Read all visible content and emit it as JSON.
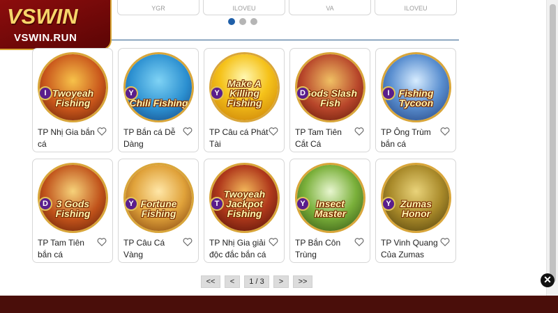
{
  "logo": {
    "brand": "VSWIN",
    "url": "VSWIN.RUN"
  },
  "top_cards": [
    "YGR",
    "ILOVEU",
    "VA",
    "ILOVEU"
  ],
  "games": [
    {
      "name": "TP Nhị Gia bắn cá",
      "badge": "I",
      "art": "Twoyeah Fishing"
    },
    {
      "name": "TP Bắn cá Dễ Dàng",
      "badge": "Y",
      "art": "Chili Fishing"
    },
    {
      "name": "TP Câu cá Phát Tài",
      "badge": "Y",
      "art": "Make A Killing Fishing"
    },
    {
      "name": "TP Tam Tiên Cắt Cá",
      "badge": "D",
      "art": "Gods Slash Fish"
    },
    {
      "name": "TP Ông Trùm bắn cá",
      "badge": "I",
      "art": "Fishing Tycoon"
    },
    {
      "name": "TP Tam Tiên bắn cá",
      "badge": "D",
      "art": "3 Gods Fishing"
    },
    {
      "name": "TP Câu Cá Vàng",
      "badge": "Y",
      "art": "Fortune Fishing"
    },
    {
      "name": "TP Nhị Gia giải độc đắc bắn cá",
      "badge": "T",
      "art": "Twoyeah Jackpot Fishing"
    },
    {
      "name": "TP Bắn Côn Trùng",
      "badge": "Y",
      "art": "Insect Master"
    },
    {
      "name": "TP Vinh Quang Của Zumas",
      "badge": "Y",
      "art": "Zumas Honor"
    }
  ],
  "pagination": {
    "first": "<<",
    "prev": "<",
    "page": "1 / 3",
    "next": ">",
    "last": ">>"
  },
  "close_label": "✕",
  "colors": {
    "accent_blue": "#1f5fa8",
    "brand_red": "#8c0d0d",
    "gold": "#d9a63a",
    "footer": "#4a0e0a"
  }
}
